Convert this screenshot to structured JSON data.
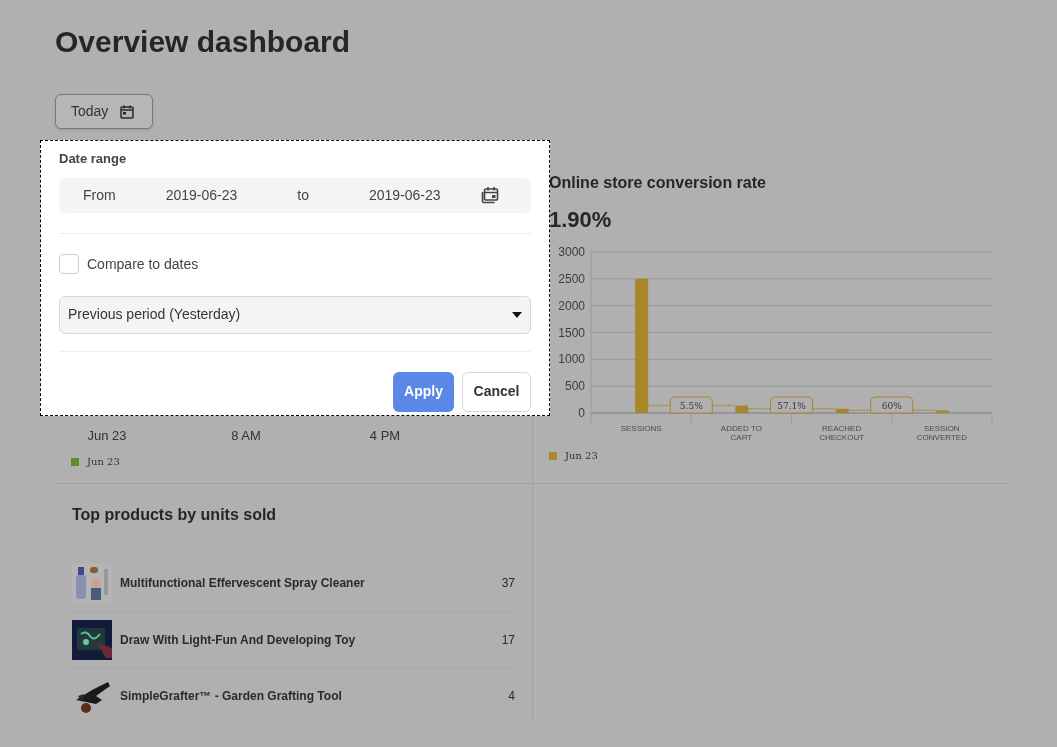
{
  "page_title": "Overview dashboard",
  "date_button": {
    "label": "Today"
  },
  "date_popup": {
    "title": "Date range",
    "from_label": "From",
    "from_value": "2019-06-23",
    "to_label": "to",
    "to_value": "2019-06-23",
    "compare": {
      "label": "Compare to dates",
      "checked": false
    },
    "compare_select": {
      "value": "Previous period (Yesterday)"
    },
    "buttons": [
      {
        "label": "Apply",
        "kind": "primary"
      },
      {
        "label": "Cancel",
        "kind": "secondary"
      }
    ]
  },
  "sales_chart": {
    "x_labels": [
      "Jun 23",
      "8 AM",
      "4 PM"
    ],
    "legend": {
      "label": "Jun 23",
      "color": "#5a8f2c"
    }
  },
  "conversion": {
    "title": "Online store conversion rate",
    "value": "1.90%",
    "chart_data": {
      "type": "bar",
      "categories": [
        "SESSIONS",
        "ADDED TO CART",
        "REACHED CHECKOUT",
        "SESSION CONVERTED"
      ],
      "series": [
        {
          "name": "Jun 23",
          "color": "#a8862a",
          "values": [
            2500,
            140,
            80,
            50
          ]
        }
      ],
      "grid": true,
      "ylim": [
        0,
        3000
      ],
      "yticks": [
        0,
        500,
        1000,
        1500,
        2000,
        2500,
        3000
      ],
      "annotations": [
        "5.5%",
        "57.1%",
        "60%"
      ]
    }
  },
  "top_products": {
    "title": "Top products by units sold",
    "items": [
      {
        "name": "Multifunctional Effervescent Spray Cleaner",
        "units": "37"
      },
      {
        "name": "Draw With Light-Fun And Developing Toy",
        "units": "17"
      },
      {
        "name": "SimpleGrafter™ - Garden Grafting Tool",
        "units": "4"
      }
    ]
  }
}
